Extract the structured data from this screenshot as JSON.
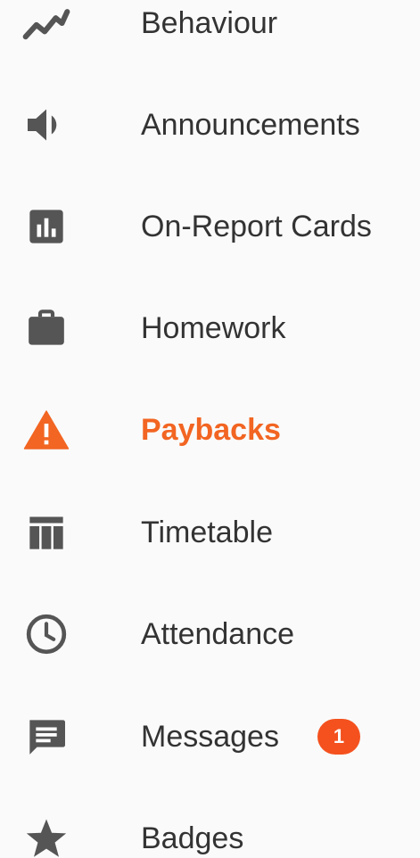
{
  "accent_color": "#f26522",
  "icon_color": "#555555",
  "text_color": "#333333",
  "badge_color": "#f4511e",
  "nav": {
    "items": [
      {
        "label": "Behaviour",
        "icon": "trending-line-icon"
      },
      {
        "label": "Announcements",
        "icon": "speaker-icon"
      },
      {
        "label": "On-Report Cards",
        "icon": "bar-chart-icon"
      },
      {
        "label": "Homework",
        "icon": "briefcase-icon"
      },
      {
        "label": "Paybacks",
        "icon": "warning-icon",
        "active": true
      },
      {
        "label": "Timetable",
        "icon": "table-icon"
      },
      {
        "label": "Attendance",
        "icon": "clock-icon"
      },
      {
        "label": "Messages",
        "icon": "message-icon",
        "badge": "1"
      },
      {
        "label": "Badges",
        "icon": "star-icon"
      }
    ]
  }
}
